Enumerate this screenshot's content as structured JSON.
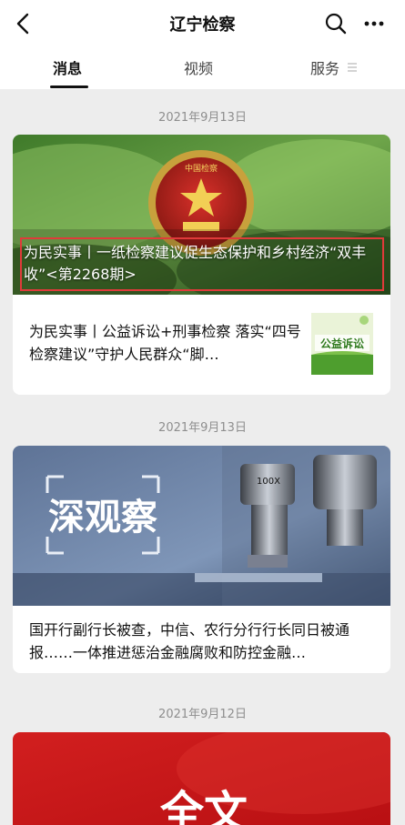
{
  "header": {
    "title": "辽宁检察",
    "back_icon": "chevron-left-icon",
    "search_icon": "search-icon",
    "more_icon": "more-dots-icon"
  },
  "tabs": [
    {
      "label": "消息",
      "active": true
    },
    {
      "label": "视频",
      "active": false
    },
    {
      "label": "服务",
      "active": false
    }
  ],
  "feed": [
    {
      "date": "2021年9月13日",
      "main": {
        "title": "为民实事丨一纸检察建议促生态保护和乡村经济“双丰收”<第2268期>",
        "image_emblem_text": "中国检察"
      },
      "sub": {
        "title": "为民实事丨公益诉讼+刑事检察 落实“四号检察建议”守护人民群众“脚…",
        "thumb_text": "公益诉讼"
      }
    },
    {
      "date": "2021年9月13日",
      "main": {
        "image_text": "深观察",
        "image_lens_text": "100X",
        "title": "国开行副行长被查，中信、农行分行行长同日被通报……一体推进惩治金融腐败和防控金融…"
      }
    },
    {
      "date": "2021年9月12日",
      "main": {
        "image_text": "全文"
      }
    }
  ],
  "colors": {
    "accent_red": "#e03a3a",
    "background": "#ededed",
    "date_gray": "#8e8e8e"
  }
}
